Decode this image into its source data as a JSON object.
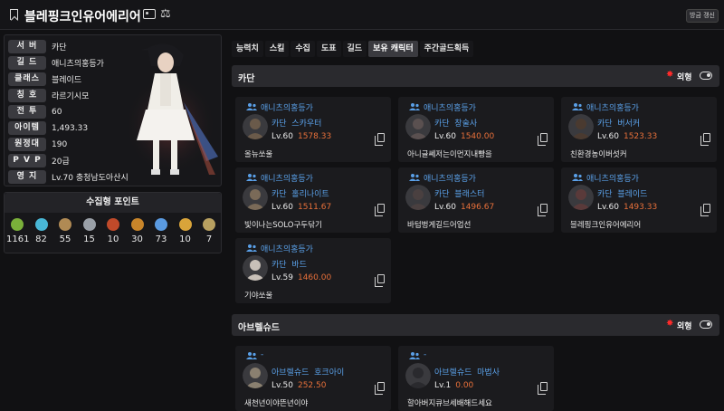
{
  "header": {
    "name": "블레핑크인유어에리어",
    "renew_label": "방금 갱신"
  },
  "profile": {
    "rows": [
      {
        "label": "서 버",
        "value": "카단"
      },
      {
        "label": "길 드",
        "value": "애니츠의홍등가"
      },
      {
        "label": "클래스",
        "value": "블레이드"
      },
      {
        "label": "칭 호",
        "value": "라르기시모"
      },
      {
        "label": "전 투",
        "value": "60"
      },
      {
        "label": "아이템",
        "value": "1,493.33"
      },
      {
        "label": "원정대",
        "value": "190"
      },
      {
        "label": "P V P",
        "value": "20급"
      },
      {
        "label": "영 지",
        "value": "Lv.70 충청남도아산시"
      }
    ]
  },
  "collect": {
    "title": "수집형 포인트",
    "items": [
      {
        "icon": "mokoko-seed-icon",
        "color": "#7ab03a",
        "value": "1161"
      },
      {
        "icon": "island-heart-icon",
        "color": "#49b7d6",
        "value": "82"
      },
      {
        "icon": "great-art-icon",
        "color": "#b08a54",
        "value": "55"
      },
      {
        "icon": "giant-heart-icon",
        "color": "#9aa0a8",
        "value": "15"
      },
      {
        "icon": "ignea-token-icon",
        "color": "#c04a2a",
        "value": "10"
      },
      {
        "icon": "adventure-book-icon",
        "color": "#c8852a",
        "value": "30"
      },
      {
        "icon": "world-tree-leaf-icon",
        "color": "#5a9ae0",
        "value": "73"
      },
      {
        "icon": "sea-bounty-icon",
        "color": "#d9a43a",
        "value": "10"
      },
      {
        "icon": "orpheus-star-icon",
        "color": "#b8a060",
        "value": "7"
      }
    ]
  },
  "tabs": [
    "능력치",
    "스킬",
    "수집",
    "도표",
    "길드",
    "보유 캐릭터",
    "주간골드획득"
  ],
  "active_tab": "보유 캐릭터",
  "sections": [
    {
      "title": "카단",
      "toggle_label": "외형",
      "cards": [
        {
          "guild": "애니츠의홍등가",
          "server": "카단",
          "cls": "스카우터",
          "level": "Lv.60",
          "ilvl": "1578.33",
          "name": "올뉴쏘울",
          "avatar_color": "#6a5a4a"
        },
        {
          "guild": "애니츠의홍등가",
          "server": "카단",
          "cls": "창술사",
          "level": "Lv.60",
          "ilvl": "1540.00",
          "name": "아니글쎄저는이먼지내빵을",
          "avatar_color": "#5a5050"
        },
        {
          "guild": "애니츠의홍등가",
          "server": "카단",
          "cls": "버서커",
          "level": "Lv.60",
          "ilvl": "1523.33",
          "name": "친환경농이버섯커",
          "avatar_color": "#4a3a30"
        },
        {
          "guild": "애니츠의홍등가",
          "server": "카단",
          "cls": "홀리나이트",
          "level": "Lv.60",
          "ilvl": "1511.67",
          "name": "빛이나는SOLO구두닦기",
          "avatar_color": "#7a6a58"
        },
        {
          "guild": "애니츠의홍등가",
          "server": "카단",
          "cls": "블래스터",
          "level": "Lv.60",
          "ilvl": "1496.67",
          "name": "바텀벙게길드어업선",
          "avatar_color": "#4a4040"
        },
        {
          "guild": "애니츠의홍등가",
          "server": "카단",
          "cls": "블레이드",
          "level": "Lv.60",
          "ilvl": "1493.33",
          "name": "블레핑크인유어에리어",
          "avatar_color": "#5a3a3a"
        },
        {
          "guild": "애니츠의홍등가",
          "server": "카단",
          "cls": "바드",
          "level": "Lv.59",
          "ilvl": "1460.00",
          "name": "기야쏘울",
          "avatar_color": "#c8c0b8"
        }
      ]
    },
    {
      "title": "아브렐슈드",
      "toggle_label": "외형",
      "cards": [
        {
          "guild": "-",
          "server": "아브렐슈드",
          "cls": "호크아이",
          "level": "Lv.50",
          "ilvl": "252.50",
          "name": "새천년이야뜬년이야",
          "avatar_color": "#8a8070"
        },
        {
          "guild": "-",
          "server": "아브렐슈드",
          "cls": "마법사",
          "level": "Lv.1",
          "ilvl": "0.00",
          "name": "할아버지큐브세배해드세요",
          "avatar_color": "#2a2a2e"
        }
      ]
    }
  ]
}
